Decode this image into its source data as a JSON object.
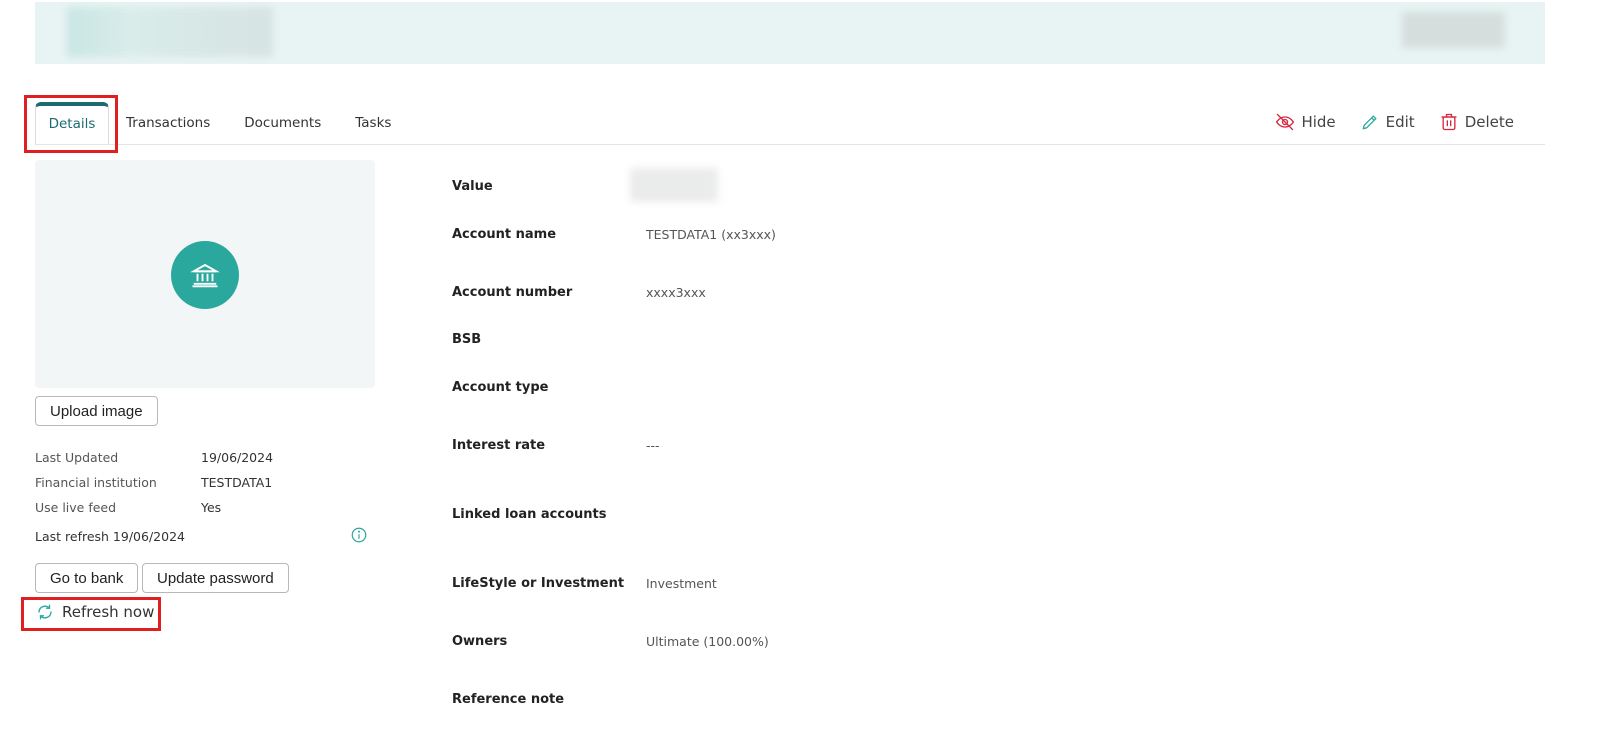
{
  "tabs": [
    {
      "label": "Details"
    },
    {
      "label": "Transactions"
    },
    {
      "label": "Documents"
    },
    {
      "label": "Tasks"
    }
  ],
  "actions": {
    "hide": "Hide",
    "edit": "Edit",
    "delete": "Delete"
  },
  "left": {
    "upload_label": "Upload image",
    "last_updated_label": "Last Updated",
    "last_updated_value": "19/06/2024",
    "institution_label": "Financial institution",
    "institution_value": "TESTDATA1",
    "live_feed_label": "Use live feed",
    "live_feed_value": "Yes",
    "last_refresh": "Last refresh 19/06/2024",
    "go_to_bank": "Go to bank",
    "update_password": "Update password",
    "refresh_now": "Refresh now"
  },
  "details": {
    "value_label": "Value",
    "account_name_label": "Account name",
    "account_name_value": "TESTDATA1 (xx3xxx)",
    "account_number_label": "Account number",
    "account_number_value": "xxxx3xxx",
    "bsb_label": "BSB",
    "account_type_label": "Account type",
    "interest_rate_label": "Interest rate",
    "interest_rate_value": "---",
    "linked_loans_label": "Linked loan accounts",
    "lifestyle_label": "LifeStyle or Investment",
    "lifestyle_value": "Investment",
    "owners_label": "Owners",
    "owners_value": "Ultimate (100.00%)",
    "reference_label": "Reference note"
  },
  "colors": {
    "accent": "#2ba89e",
    "danger": "#d7263d",
    "tab_active": "#1d6b6f",
    "highlight": "#e02020"
  },
  "icons": {
    "bank": "bank-icon",
    "hide": "eye-off-icon",
    "edit": "pencil-icon",
    "delete": "trash-icon",
    "info": "info-icon",
    "refresh": "refresh-icon"
  }
}
